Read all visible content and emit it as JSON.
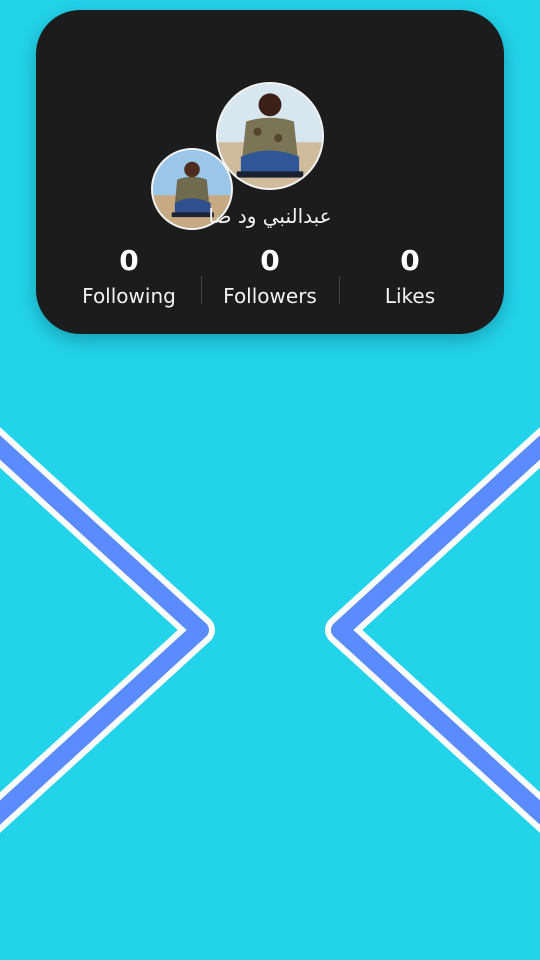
{
  "profile": {
    "username": "عبدالنبي ود صا",
    "stats": [
      {
        "value": "0",
        "label": "Following"
      },
      {
        "value": "0",
        "label": "Followers"
      },
      {
        "value": "0",
        "label": "Likes"
      }
    ]
  },
  "colors": {
    "background": "#22D3EA",
    "card": "#1C1C1C",
    "chevron": "#5B8CFF"
  },
  "icons": {
    "left": "chevron-right-icon",
    "right": "chevron-left-icon"
  }
}
